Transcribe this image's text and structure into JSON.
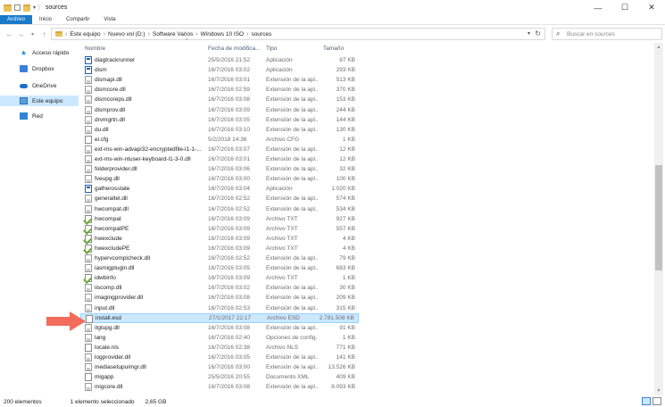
{
  "window": {
    "title": "sources",
    "minimize": "—",
    "maximize": "☐",
    "close": "✕"
  },
  "ribbon": {
    "tabs": [
      "Archivo",
      "Inicio",
      "Compartir",
      "Vista"
    ]
  },
  "nav": {
    "back": "←",
    "forward": "→",
    "recent": "▾",
    "up": "↑"
  },
  "address": {
    "crumbs": [
      "Este equipo",
      "Nuevo vol (D:)",
      "Software Varios",
      "Windows 10 ISO",
      "sources"
    ],
    "separator": "›",
    "dropdown": "▾",
    "refresh": "↻"
  },
  "search": {
    "placeholder": "Buscar en sources",
    "icon": "⌕"
  },
  "sidebar": {
    "items": [
      {
        "label": "Acceso rápido",
        "icon": "star-icon"
      },
      {
        "label": "Dropbox",
        "icon": "dropbox-icon"
      },
      {
        "label": "OneDrive",
        "icon": "cloud-icon"
      },
      {
        "label": "Este equipo",
        "icon": "computer-icon"
      },
      {
        "label": "Red",
        "icon": "network-icon"
      }
    ],
    "selected_index": 3
  },
  "columns": {
    "name": "Nombre",
    "date": "Fecha de modifica...",
    "type": "Tipo",
    "size": "Tamaño",
    "sort_arrow": "^"
  },
  "files": [
    {
      "name": "diagtrackrunner",
      "date": "25/5/2016 21:52",
      "type": "Aplicación",
      "size": "87 KB",
      "icon": "app"
    },
    {
      "name": "dism",
      "date": "16/7/2016 03:02",
      "type": "Aplicación",
      "size": "293 KB",
      "icon": "app"
    },
    {
      "name": "dismapi.dll",
      "date": "16/7/2016 03:01",
      "type": "Extensión de la apl...",
      "size": "513 KB",
      "icon": "dll"
    },
    {
      "name": "dismcore.dll",
      "date": "16/7/2016 02:59",
      "type": "Extensión de la apl...",
      "size": "370 KB",
      "icon": "dll"
    },
    {
      "name": "dismcoreps.dll",
      "date": "16/7/2016 03:08",
      "type": "Extensión de la apl...",
      "size": "153 KB",
      "icon": "dll"
    },
    {
      "name": "dismprov.dll",
      "date": "16/7/2016 03:09",
      "type": "Extensión de la apl...",
      "size": "244 KB",
      "icon": "dll"
    },
    {
      "name": "drvmgrtn.dll",
      "date": "16/7/2016 03:05",
      "type": "Extensión de la apl...",
      "size": "144 KB",
      "icon": "dll"
    },
    {
      "name": "du.dll",
      "date": "16/7/2016 03:10",
      "type": "Extensión de la apl...",
      "size": "130 KB",
      "icon": "dll"
    },
    {
      "name": "ei.cfg",
      "date": "5/2/2018 14:36",
      "type": "Archivo CFG",
      "size": "1 KB",
      "icon": "plain"
    },
    {
      "name": "ext-ms-win-advapi32-encryptedfile-l1-1-...",
      "date": "16/7/2016 03:07",
      "type": "Extensión de la apl...",
      "size": "12 KB",
      "icon": "dll"
    },
    {
      "name": "ext-ms-win-ntuser-keyboard-l1-3-0.dll",
      "date": "16/7/2016 03:01",
      "type": "Extensión de la apl...",
      "size": "12 KB",
      "icon": "dll"
    },
    {
      "name": "folderprovider.dll",
      "date": "16/7/2016 03:06",
      "type": "Extensión de la apl...",
      "size": "32 KB",
      "icon": "dll"
    },
    {
      "name": "fveupg.dll",
      "date": "16/7/2016 03:00",
      "type": "Extensión de la apl...",
      "size": "100 KB",
      "icon": "dll"
    },
    {
      "name": "gatherosstate",
      "date": "16/7/2016 03:04",
      "type": "Aplicación",
      "size": "1.020 KB",
      "icon": "app"
    },
    {
      "name": "generaltel.dll",
      "date": "16/7/2016 02:52",
      "type": "Extensión de la apl...",
      "size": "574 KB",
      "icon": "dll"
    },
    {
      "name": "hwcompat.dll",
      "date": "16/7/2016 02:52",
      "type": "Extensión de la apl...",
      "size": "534 KB",
      "icon": "dll"
    },
    {
      "name": "hwcompat",
      "date": "16/7/2016 03:09",
      "type": "Archivo TXT",
      "size": "927 KB",
      "icon": "txt"
    },
    {
      "name": "hwcompatPE",
      "date": "16/7/2016 03:09",
      "type": "Archivo TXT",
      "size": "557 KB",
      "icon": "txt"
    },
    {
      "name": "hwexclude",
      "date": "16/7/2016 03:09",
      "type": "Archivo TXT",
      "size": "4 KB",
      "icon": "txt"
    },
    {
      "name": "hwexcludePE",
      "date": "16/7/2016 03:09",
      "type": "Archivo TXT",
      "size": "4 KB",
      "icon": "txt"
    },
    {
      "name": "hypervcomplcheck.dll",
      "date": "16/7/2016 02:52",
      "type": "Extensión de la apl...",
      "size": "79 KB",
      "icon": "dll"
    },
    {
      "name": "iasmigplugin.dll",
      "date": "16/7/2016 03:05",
      "type": "Extensión de la apl...",
      "size": "683 KB",
      "icon": "dll"
    },
    {
      "name": "idwbinfo",
      "date": "16/7/2016 03:09",
      "type": "Archivo TXT",
      "size": "1 KB",
      "icon": "txt"
    },
    {
      "name": "iiscomp.dll",
      "date": "16/7/2016 03:02",
      "type": "Extensión de la apl...",
      "size": "30 KB",
      "icon": "dll"
    },
    {
      "name": "imagingprovider.dll",
      "date": "16/7/2016 03:08",
      "type": "Extensión de la apl...",
      "size": "209 KB",
      "icon": "dll"
    },
    {
      "name": "input.dll",
      "date": "16/7/2016 02:53",
      "type": "Extensión de la apl...",
      "size": "315 KB",
      "icon": "dll"
    },
    {
      "name": "install.esd",
      "date": "27/1/2017 22:17",
      "type": "Archivo ESD",
      "size": "2.781.508 KB",
      "icon": "plain"
    },
    {
      "name": "itgtupg.dll",
      "date": "16/7/2016 03:08",
      "type": "Extensión de la apl...",
      "size": "91 KB",
      "icon": "dll"
    },
    {
      "name": "lang",
      "date": "16/7/2016 02:40",
      "type": "Opciones de config...",
      "size": "1 KB",
      "icon": "dll"
    },
    {
      "name": "locale.nls",
      "date": "16/7/2016 02:38",
      "type": "Archivo NLS",
      "size": "771 KB",
      "icon": "plain"
    },
    {
      "name": "logprovider.dll",
      "date": "16/7/2016 03:05",
      "type": "Extensión de la apl...",
      "size": "141 KB",
      "icon": "dll"
    },
    {
      "name": "mediasetupuimgr.dll",
      "date": "16/7/2016 03:00",
      "type": "Extensión de la apl...",
      "size": "13.526 KB",
      "icon": "dll"
    },
    {
      "name": "migapp",
      "date": "25/5/2016 20:55",
      "type": "Documento XML",
      "size": "409 KB",
      "icon": "plain"
    },
    {
      "name": "migcore.dll",
      "date": "16/7/2016 03:08",
      "type": "Extensión de la apl...",
      "size": "8.093 KB",
      "icon": "dll"
    }
  ],
  "selected_file_index": 26,
  "annotation": {
    "arrow_color": "#f26b5b"
  },
  "status": {
    "count": "200 elementos",
    "selection": "1 elemento seleccionado",
    "size": "2,65 GB"
  },
  "colors": {
    "accent": "#1979ca",
    "selection_bg": "#cce8ff",
    "selection_border": "#99d1ff"
  }
}
